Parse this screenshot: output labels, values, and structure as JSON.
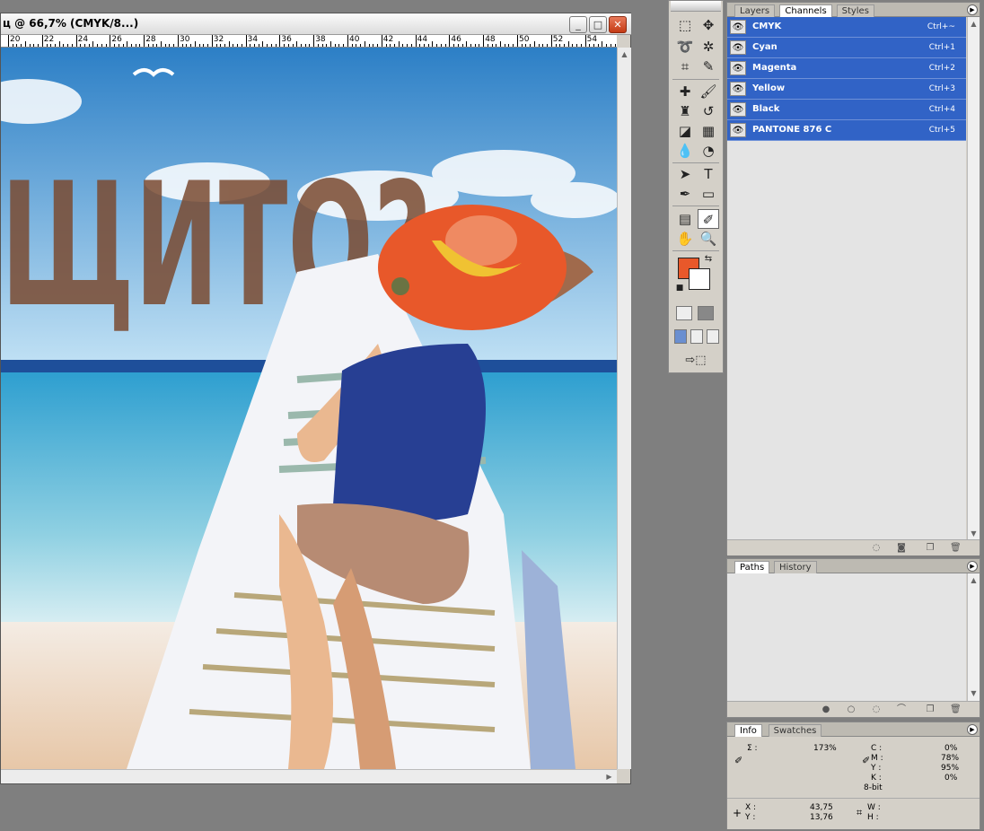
{
  "document": {
    "title": "ц @ 66,7% (CMYK/8...)",
    "ruler_labels": [
      "20",
      "22",
      "24",
      "26",
      "28",
      "30",
      "32",
      "34",
      "36",
      "38",
      "40",
      "42",
      "44",
      "46",
      "48",
      "50",
      "52",
      "54",
      "5("
    ],
    "artwork_text": "ЩИТО?",
    "buttons": {
      "minimize": "_",
      "maximize": "□",
      "close": "✕"
    }
  },
  "toolbox": {
    "foreground_color": "#e8582a",
    "background_color": "#ffffff",
    "tools": [
      {
        "name": "marquee-tool-icon",
        "glyph": "⬚"
      },
      {
        "name": "move-tool-icon",
        "glyph": "✥"
      },
      {
        "name": "lasso-tool-icon",
        "glyph": "➰"
      },
      {
        "name": "magic-wand-tool-icon",
        "glyph": "✲"
      },
      {
        "name": "crop-tool-icon",
        "glyph": "⌗"
      },
      {
        "name": "slice-tool-icon",
        "glyph": "✎"
      },
      {
        "name": "healing-brush-tool-icon",
        "glyph": "✚"
      },
      {
        "name": "brush-tool-icon",
        "glyph": "🖌"
      },
      {
        "name": "stamp-tool-icon",
        "glyph": "♜"
      },
      {
        "name": "history-brush-tool-icon",
        "glyph": "↺"
      },
      {
        "name": "eraser-tool-icon",
        "glyph": "◪"
      },
      {
        "name": "gradient-tool-icon",
        "glyph": "▦"
      },
      {
        "name": "blur-tool-icon",
        "glyph": "💧"
      },
      {
        "name": "dodge-tool-icon",
        "glyph": "◔"
      },
      {
        "name": "path-select-tool-icon",
        "glyph": "➤"
      },
      {
        "name": "type-tool-icon",
        "glyph": "T"
      },
      {
        "name": "pen-tool-icon",
        "glyph": "✒"
      },
      {
        "name": "shape-tool-icon",
        "glyph": "▭"
      },
      {
        "name": "notes-tool-icon",
        "glyph": "▤"
      },
      {
        "name": "eyedropper-tool-icon",
        "glyph": "✐"
      },
      {
        "name": "hand-tool-icon",
        "glyph": "✋"
      },
      {
        "name": "zoom-tool-icon",
        "glyph": "🔍"
      }
    ]
  },
  "channels_panel": {
    "tabs": [
      "Layers",
      "Channels",
      "Styles"
    ],
    "active_tab": "Channels",
    "channels": [
      {
        "name": "CMYK",
        "shortcut": "Ctrl+~"
      },
      {
        "name": "Cyan",
        "shortcut": "Ctrl+1"
      },
      {
        "name": "Magenta",
        "shortcut": "Ctrl+2"
      },
      {
        "name": "Yellow",
        "shortcut": "Ctrl+3"
      },
      {
        "name": "Black",
        "shortcut": "Ctrl+4"
      },
      {
        "name": "PANTONE 876 C",
        "shortcut": "Ctrl+5"
      }
    ],
    "selection_color": "#3163c6"
  },
  "paths_panel": {
    "tabs": [
      "Paths",
      "History"
    ],
    "active_tab": "Paths"
  },
  "info_panel": {
    "tabs": [
      "Info",
      "Swatches"
    ],
    "active_tab": "Info",
    "sigma_label": "Σ :",
    "sigma_value": "173%",
    "c_label": "C :",
    "c_value": "0%",
    "m_label": "M :",
    "m_value": "78%",
    "y_label": "Y :",
    "y_value": "95%",
    "k_label": "K :",
    "k_value": "0%",
    "bit_depth": "8-bit",
    "x_label": "X :",
    "x_value": "43,75",
    "y2_label": "Y :",
    "y2_value": "13,76",
    "w_label": "W :",
    "w_value": "",
    "h_label": "H :",
    "h_value": ""
  }
}
